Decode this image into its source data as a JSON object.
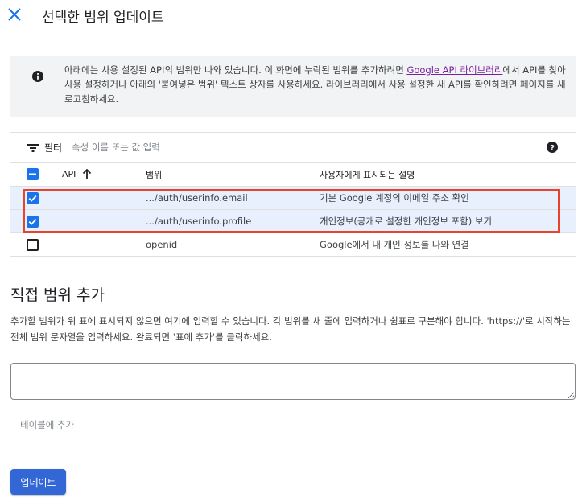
{
  "header": {
    "title": "선택한 범위 업데이트",
    "close_icon": "close-icon"
  },
  "info": {
    "icon": "info-icon",
    "text_before": "아래에는 사용 설정된 API의 범위만 나와 있습니다. 이 화면에 누락된 범위를 추가하려면 ",
    "link": "Google API 라이브러리",
    "text_after": "에서 API를 찾아 사용 설정하거나 아래의 '붙여넣은 범위' 텍스트 상자를 사용하세요. 라이브러리에서 사용 설정한 새 API를 확인하려면 페이지를 새로고침하세요."
  },
  "filter": {
    "icon": "filter-icon",
    "label": "필터",
    "placeholder": "속성 이름 또는 값 입력",
    "help_icon": "help-icon"
  },
  "table": {
    "columns": {
      "api": "API",
      "scope": "범위",
      "description": "사용자에게 표시되는 설명"
    },
    "sort_icon": "arrow-up-icon",
    "header_checkbox": "indeterminate",
    "rows": [
      {
        "checked": true,
        "api": "",
        "scope": ".../auth/userinfo.email",
        "description": "기본 Google 계정의 이메일 주소 확인"
      },
      {
        "checked": true,
        "api": "",
        "scope": ".../auth/userinfo.profile",
        "description": "개인정보(공개로 설정한 개인정보 포함) 보기"
      },
      {
        "checked": false,
        "api": "",
        "scope": "openid",
        "description": "Google에서 내 개인 정보를 나와 연결"
      }
    ]
  },
  "manual": {
    "title": "직접 범위 추가",
    "description": "추가할 범위가 위 표에 표시되지 않으면 여기에 입력할 수 있습니다. 각 범위를 새 줄에 입력하거나 쉼표로 구분해야 합니다. 'https://'로 시작하는 전체 범위 문자열을 입력하세요. 완료되면 '표에 추가'를 클릭하세요.",
    "input_value": "",
    "add_label": "테이블에 추가"
  },
  "footer": {
    "update_label": "업데이트"
  },
  "colors": {
    "primary": "#1a73e8",
    "update_button": "#3367d6",
    "highlight_border": "#e8432d",
    "selected_row": "#e8f0fe",
    "info_bg": "#f1f3f4"
  }
}
